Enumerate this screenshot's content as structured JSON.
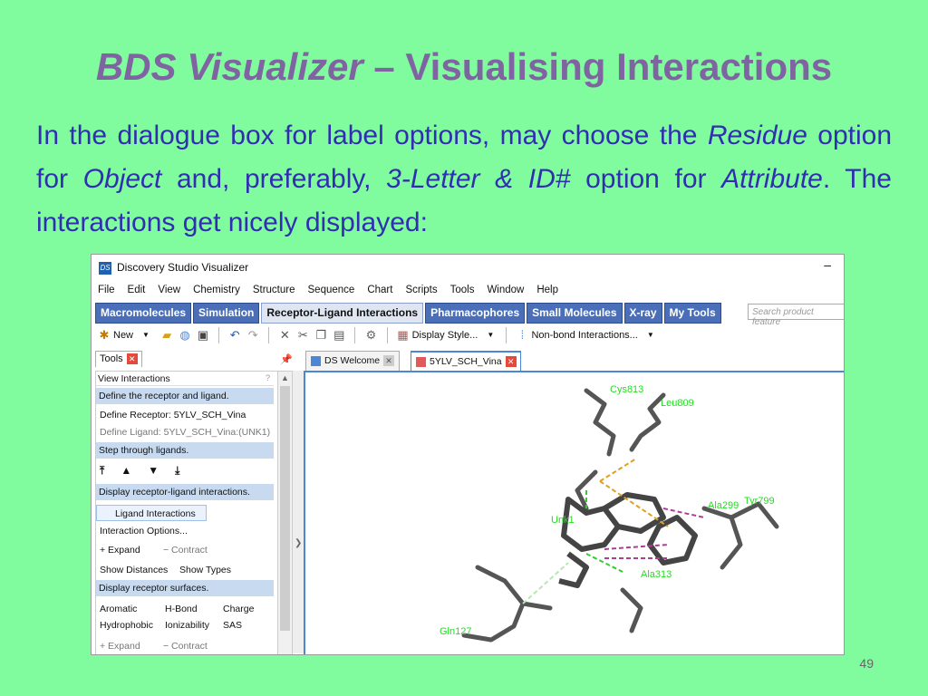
{
  "slide": {
    "title_em": "BDS Visualizer",
    "title_rest": " – Visualising Interactions",
    "body": {
      "p1": "In the dialogue box for label options, may choose the ",
      "residue": "Residue",
      "p2": " option for ",
      "object": "Object",
      "p3": " and, preferably, ",
      "letter": "3-Letter & ID#",
      "p4": " option for ",
      "attribute": "Attribute",
      "p5": ". The interactions get nicely displayed:"
    },
    "page_number": "49"
  },
  "app": {
    "icon_text": "DS",
    "window_title": "Discovery Studio Visualizer",
    "minimize": "–",
    "menu": [
      "File",
      "Edit",
      "View",
      "Chemistry",
      "Structure",
      "Sequence",
      "Chart",
      "Scripts",
      "Tools",
      "Window",
      "Help"
    ],
    "ribbon_tabs": [
      "Macromolecules",
      "Simulation",
      "Receptor-Ligand Interactions",
      "Pharmacophores",
      "Small Molecules",
      "X-ray",
      "My Tools"
    ],
    "active_ribbon_tab": "Receptor-Ligand Interactions",
    "search_placeholder": "Search product feature",
    "toolbar": {
      "new_label": "New",
      "display_style_label": "Display Style...",
      "nonbond_label": "Non-bond Interactions..."
    },
    "tools_tab": "Tools",
    "close_x": "✕",
    "panel": {
      "header": "View Interactions",
      "help": "?",
      "define_section": "Define the receptor and ligand.",
      "define_receptor": "Define Receptor: 5YLV_SCH_Vina",
      "define_ligand": "Define Ligand: 5YLV_SCH_Vina:(UNK1)",
      "step_section": "Step through ligands.",
      "display_section": "Display receptor-ligand interactions.",
      "ligand_interactions": "Ligand Interactions",
      "interaction_options": "Interaction Options...",
      "expand": "+ Expand",
      "contract": "− Contract",
      "show_distances": "Show Distances",
      "show_types": "Show Types",
      "surfaces_section": "Display receptor surfaces.",
      "aromatic": "Aromatic",
      "hbond": "H-Bond",
      "charge": "Charge",
      "hydrophobic": "Hydrophobic",
      "ionizability": "Ionizability",
      "sas": "SAS",
      "expand2": "+ Expand",
      "contract2": "− Contract"
    },
    "doc_tabs": [
      "DS Welcome",
      "5YLV_SCH_Vina"
    ],
    "residue_labels": {
      "cys": "Cys813",
      "leu": "Leu809",
      "ala": "Ala299",
      "tyr": "Tyr799",
      "unk": "Unk1",
      "ala2": "Ala313",
      "gln": "Gln127"
    },
    "colors": {
      "slide_bg": "#80fc9e",
      "title": "#8064a2",
      "body_text": "#2f2fb0",
      "ribbon": "#4a6fb8",
      "section_bg": "#c7daf0",
      "label_green": "#22dd22",
      "hbond": "#33cc33",
      "pi": "#b03a9c",
      "sulfur": "#e0a020"
    }
  }
}
